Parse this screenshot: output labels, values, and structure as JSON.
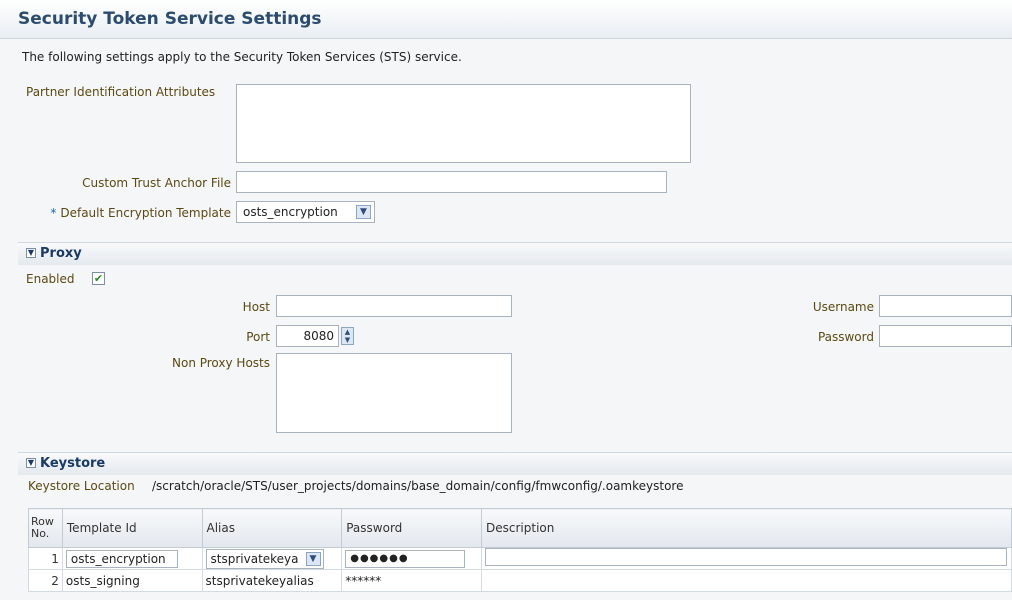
{
  "title": "Security Token Service Settings",
  "description": "The following settings apply to the Security Token Services (STS) service.",
  "general": {
    "partner_label": "Partner Identification Attributes",
    "partner_value": "",
    "trust_anchor_label": "Custom Trust Anchor File",
    "trust_anchor_value": "",
    "required_marker": "*",
    "encryption_label": "Default Encryption Template",
    "encryption_value": "osts_encryption"
  },
  "proxy": {
    "section_title": "Proxy",
    "enabled_label": "Enabled",
    "enabled_checked": true,
    "host_label": "Host",
    "host_value": "",
    "port_label": "Port",
    "port_value": "8080",
    "non_proxy_label": "Non Proxy Hosts",
    "non_proxy_value": "",
    "username_label": "Username",
    "username_value": "",
    "password_label": "Password",
    "password_value": ""
  },
  "keystore": {
    "section_title": "Keystore",
    "location_label": "Keystore Location",
    "location_value": "/scratch/oracle/STS/user_projects/domains/base_domain/config/fmwconfig/.oamkeystore",
    "columns": {
      "row_no": "Row No.",
      "template_id": "Template Id",
      "alias": "Alias",
      "password": "Password",
      "description": "Description"
    },
    "rows": [
      {
        "no": "1",
        "template_id": "osts_encryption",
        "alias": "stsprivatekeyalias",
        "alias_visible": "stsprivatekeya",
        "password": "●●●●●●",
        "description": ""
      },
      {
        "no": "2",
        "template_id": "osts_signing",
        "alias": "stsprivatekeyalias",
        "password": "******",
        "description": ""
      }
    ]
  },
  "icons": {
    "chevron": "chevron-down-icon",
    "check": "checkmark-icon",
    "spinner": "spinner-icon"
  },
  "colors": {
    "title": "#2b4b6f",
    "label": "#5a4a12",
    "section": "#1a3a66",
    "required": "#1a64a6"
  }
}
